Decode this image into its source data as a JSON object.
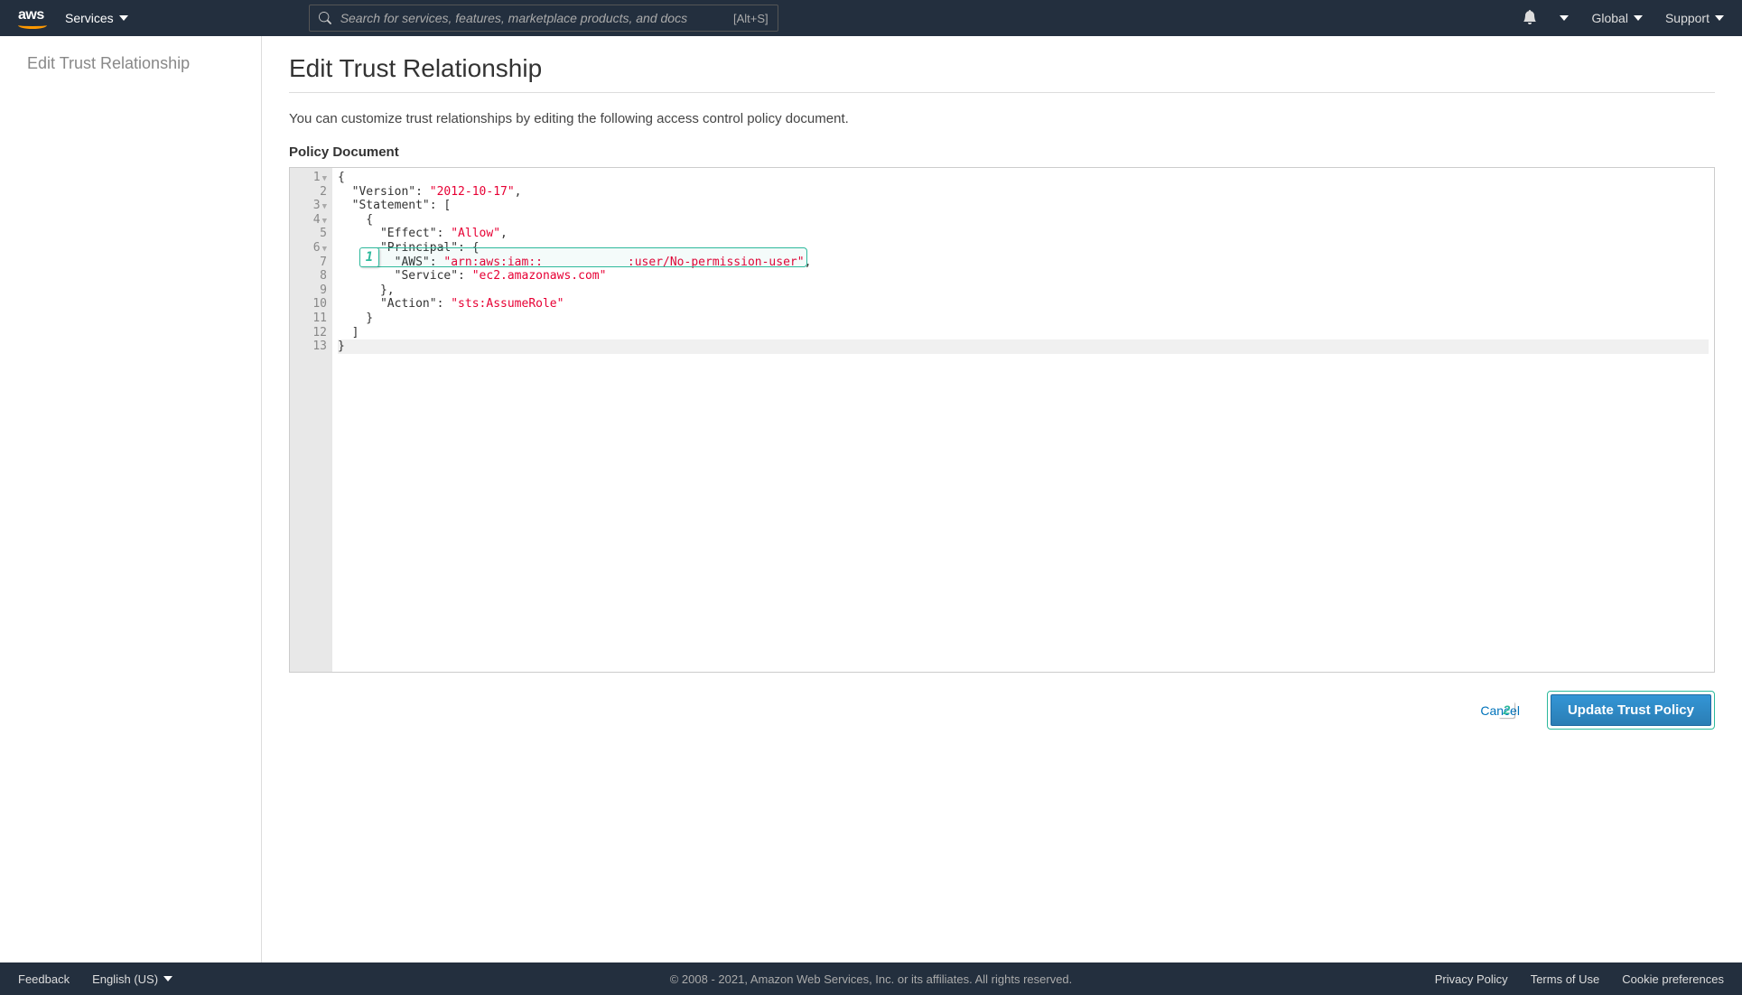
{
  "nav": {
    "services": "Services",
    "search_placeholder": "Search for services, features, marketplace products, and docs",
    "search_shortcut": "[Alt+S]",
    "global": "Global",
    "support": "Support"
  },
  "sidebar": {
    "title": "Edit Trust Relationship"
  },
  "page": {
    "title": "Edit Trust Relationship",
    "description": "You can customize trust relationships by editing the following access control policy document.",
    "section_label": "Policy Document"
  },
  "code": {
    "lines": [
      {
        "n": "1",
        "fold": true
      },
      {
        "n": "2"
      },
      {
        "n": "3",
        "fold": true
      },
      {
        "n": "4",
        "fold": true
      },
      {
        "n": "5"
      },
      {
        "n": "6",
        "fold": true
      },
      {
        "n": "7"
      },
      {
        "n": "8"
      },
      {
        "n": "9"
      },
      {
        "n": "10"
      },
      {
        "n": "11"
      },
      {
        "n": "12"
      },
      {
        "n": "13"
      }
    ],
    "l1": "{",
    "l2a": "  \"Version\": ",
    "l2b": "\"2012-10-17\"",
    "l2c": ",",
    "l3": "  \"Statement\": [",
    "l4": "    {",
    "l5a": "      \"Effect\": ",
    "l5b": "\"Allow\"",
    "l5c": ",",
    "l6": "      \"Principal\": {",
    "l7a": "        \"AWS\": ",
    "l7b": "\"arn:aws:iam::            :user/No-permission-user\"",
    "l7c": ",",
    "l8a": "        \"Service\": ",
    "l8b": "\"ec2.amazonaws.com\"",
    "l9": "      },",
    "l10a": "      \"Action\": ",
    "l10b": "\"sts:AssumeRole\"",
    "l11": "    }",
    "l12": "  ]",
    "l13": "}"
  },
  "buttons": {
    "cancel": "Cancel",
    "update": "Update Trust Policy"
  },
  "callouts": {
    "c1": "1",
    "c2": "2"
  },
  "footer": {
    "feedback": "Feedback",
    "language": "English (US)",
    "copyright": "© 2008 - 2021, Amazon Web Services, Inc. or its affiliates. All rights reserved.",
    "privacy": "Privacy Policy",
    "terms": "Terms of Use",
    "cookies": "Cookie preferences"
  }
}
